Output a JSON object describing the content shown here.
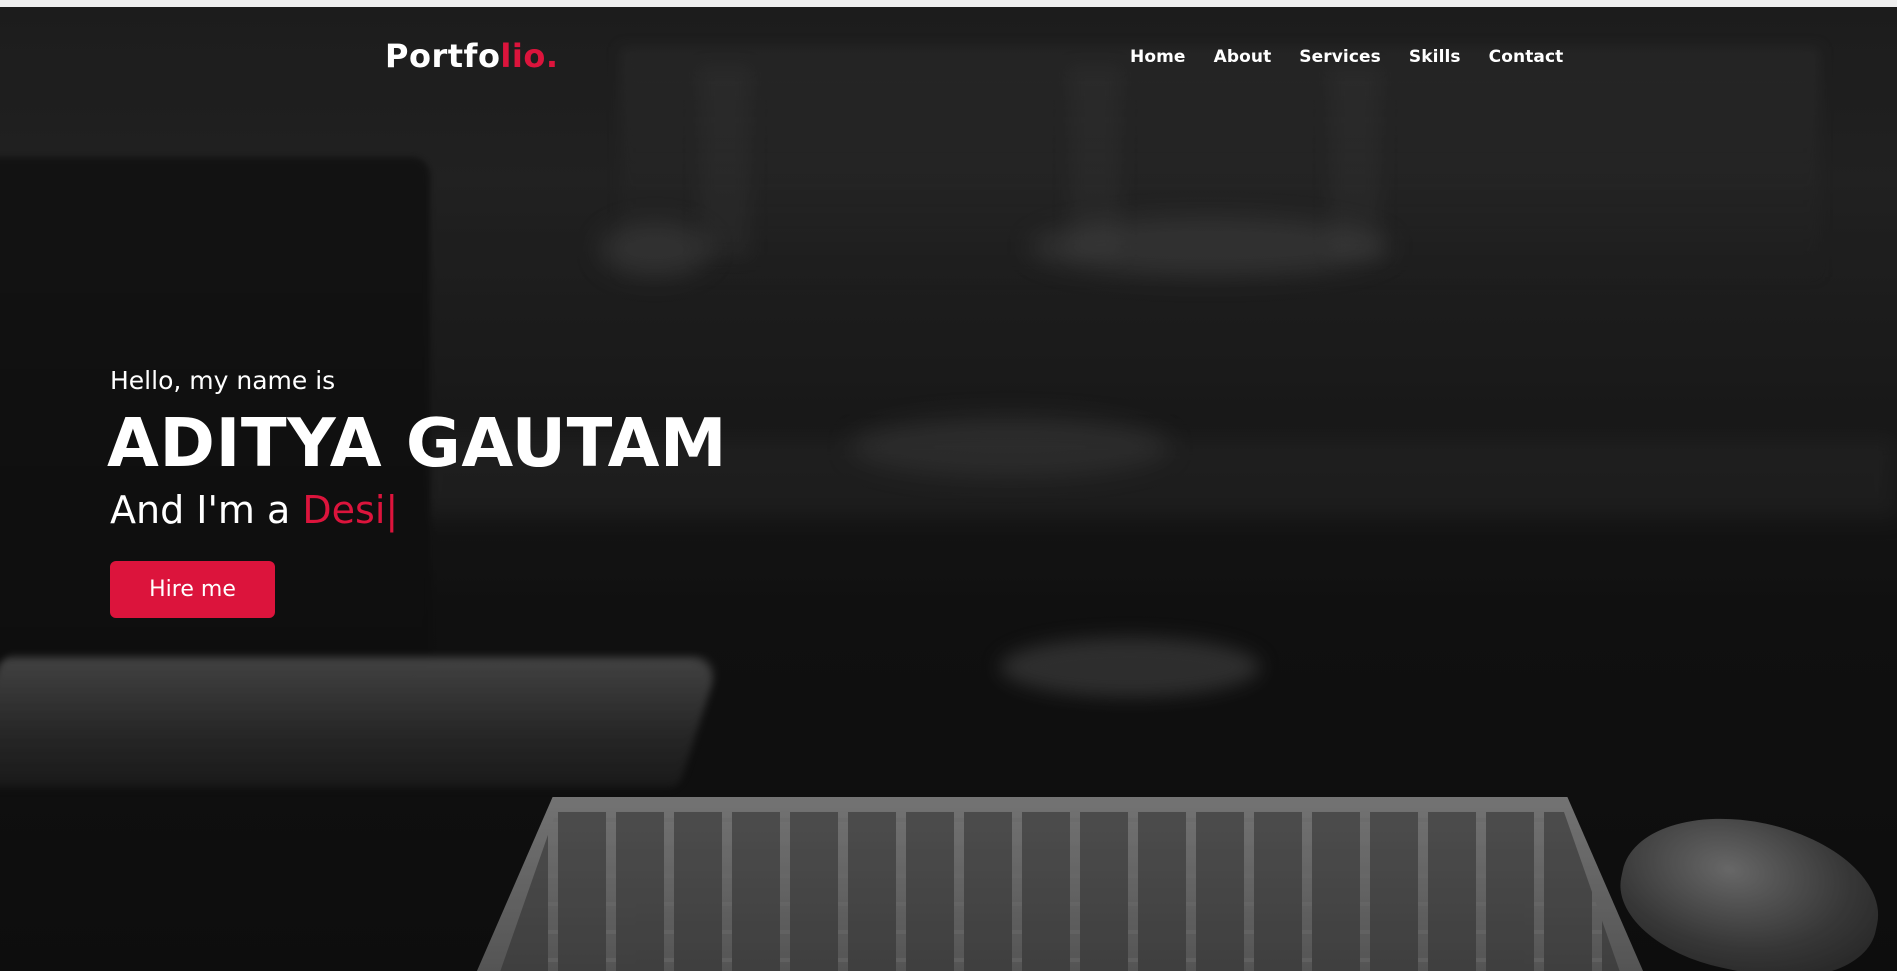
{
  "navbar": {
    "logo": {
      "main": "Portfo",
      "accent": "lio."
    },
    "items": [
      {
        "label": "Home"
      },
      {
        "label": "About"
      },
      {
        "label": "Services"
      },
      {
        "label": "Skills"
      },
      {
        "label": "Contact"
      }
    ]
  },
  "hero": {
    "greeting": "Hello, my name is",
    "name": "ADITYA GAUTAM",
    "role_prefix": "And I'm a ",
    "role_typed": "Desi",
    "cursor": "|",
    "hire_button": "Hire me"
  },
  "colors": {
    "accent": "#dc143c",
    "text": "#ffffff",
    "background": "#1a1a1a"
  }
}
